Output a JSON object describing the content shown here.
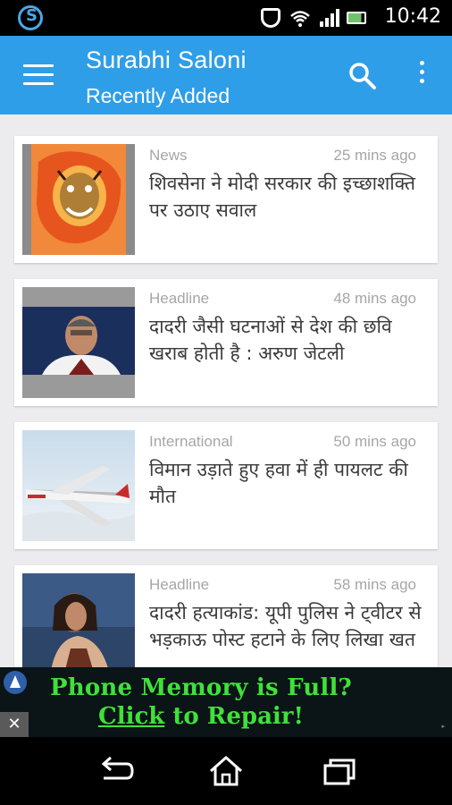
{
  "status_bar": {
    "time": "10:42",
    "icons": [
      "app-s-icon",
      "shield-icon",
      "wifi-icon",
      "signal-icon",
      "battery-icon"
    ]
  },
  "app_bar": {
    "title": "Surabhi Saloni",
    "subtitle": "Recently Added",
    "icons": [
      "menu-icon",
      "search-icon",
      "overflow-menu-icon"
    ]
  },
  "articles": [
    {
      "category": "News",
      "time": "25 mins ago",
      "headline": "शिवसेना ने मोदी सरकार की इच्छाशक्ति पर उठाए सवाल"
    },
    {
      "category": "Headline",
      "time": "48 mins ago",
      "headline": "दादरी जैसी घटनाओं से देश की छवि खराब होती है : अरुण जेटली"
    },
    {
      "category": "International",
      "time": "50 mins ago",
      "headline": "विमान उड़ाते हुए हवा में ही पायलट की मौत"
    },
    {
      "category": "Headline",
      "time": "58 mins ago",
      "headline": "दादरी हत्याकांड: यूपी पुलिस ने ट्वीटर से भड़काऊ पोस्ट हटाने के लिए लिखा खत"
    }
  ],
  "ad": {
    "line1": "Phone Memory is Full?",
    "link_text": "Click",
    "line2_rest": " to Repair!",
    "close": "✕",
    "colors": {
      "text": "#3fe13a",
      "background": "#0b1416"
    }
  },
  "nav_bar": {
    "icons": [
      "back-icon",
      "home-icon",
      "recents-icon"
    ]
  },
  "colors": {
    "app_bar": "#2f9ee8",
    "content_bg": "#ececee",
    "meta_text": "#a6a6a6",
    "headline_text": "#3a3a3a"
  }
}
